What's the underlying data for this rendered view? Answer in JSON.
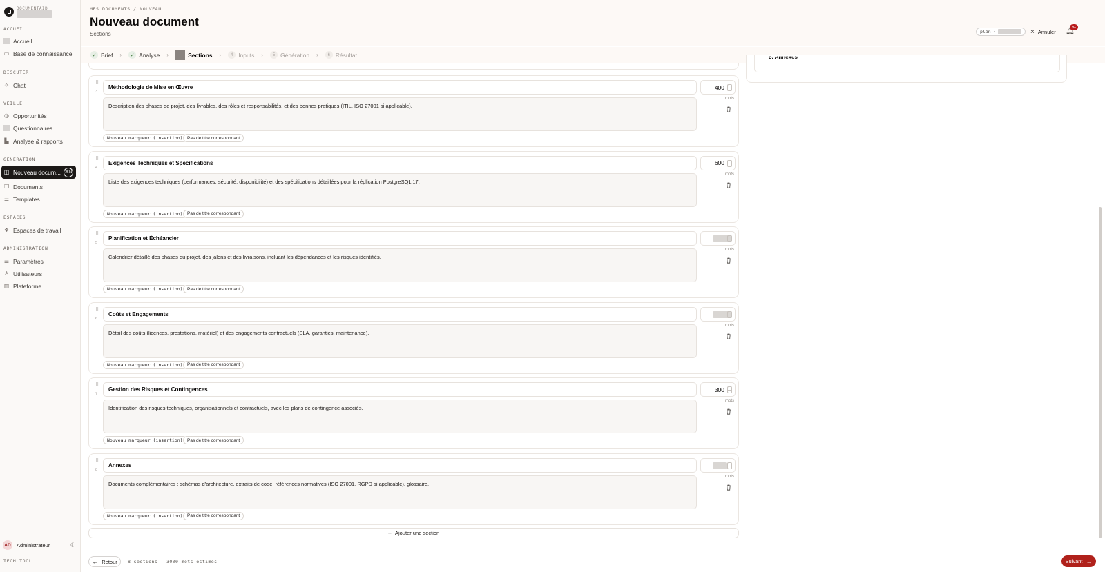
{
  "sidebar": {
    "brand": "DOCUMENTAID",
    "sections": [
      {
        "label": "ACCUEIL",
        "items": [
          {
            "label": "Accueil",
            "icon": "square-icon"
          },
          {
            "label": "Base de connaissance",
            "icon": "book-icon"
          }
        ]
      },
      {
        "label": "DISCUTER",
        "items": [
          {
            "label": "Chat",
            "icon": "sparkle-icon"
          }
        ]
      },
      {
        "label": "VEILLE",
        "items": [
          {
            "label": "Opportunités",
            "icon": "radar-icon"
          },
          {
            "label": "Questionnaires",
            "icon": "square-icon"
          },
          {
            "label": "Analyse & rapports",
            "icon": "chart-icon"
          }
        ]
      },
      {
        "label": "GÉNÉRATION",
        "items": [
          {
            "label": "Nouveau docum...",
            "icon": "file-icon",
            "active": true,
            "badge": "⌘N"
          },
          {
            "label": "Documents",
            "icon": "files-icon"
          },
          {
            "label": "Templates",
            "icon": "template-icon"
          }
        ]
      },
      {
        "label": "ESPACES",
        "items": [
          {
            "label": "Espaces de travail",
            "icon": "workspace-icon"
          }
        ]
      },
      {
        "label": "ADMINISTRATION",
        "items": [
          {
            "label": "Paramètres",
            "icon": "sliders-icon"
          },
          {
            "label": "Utilisateurs",
            "icon": "users-icon"
          },
          {
            "label": "Plateforme",
            "icon": "bars-icon"
          }
        ]
      }
    ],
    "user": {
      "initials": "AD",
      "name": "Administrateur"
    },
    "footer_label": "TECH TOOL"
  },
  "header": {
    "breadcrumb": "MES DOCUMENTS  /  NOUVEAU",
    "title": "Nouveau document",
    "subtitle": "Sections",
    "plan_label": "plan ·",
    "cancel_label": "Annuler",
    "notifications_badge": "9+"
  },
  "steps": [
    {
      "label": "Brief",
      "state": "done"
    },
    {
      "label": "Analyse",
      "state": "done"
    },
    {
      "label": "Sections",
      "state": "current"
    },
    {
      "label": "Inputs",
      "state": "pending",
      "number": "4"
    },
    {
      "label": "Génération",
      "state": "pending",
      "number": "5"
    },
    {
      "label": "Résultat",
      "state": "pending",
      "number": "6"
    }
  ],
  "sections": [
    {
      "index": "3",
      "title": "Méthodologie de Mise en Œuvre",
      "words": "400",
      "description": "Description des phases de projet, des livrables, des rôles et responsabilités, et des bonnes pratiques (ITIL, ISO 27001 si applicable)."
    },
    {
      "index": "4",
      "title": "Exigences Techniques et Spécifications",
      "words": "600",
      "description": "Liste des exigences techniques (performances, sécurité, disponibilité) et des spécifications détaillées pour la réplication PostgreSQL 17."
    },
    {
      "index": "5",
      "title": "Planification et Échéancier",
      "words": "",
      "description": "Calendrier détaillé des phases du projet, des jalons et des livraisons, incluant les dépendances et les risques identifiés."
    },
    {
      "index": "6",
      "title": "Coûts et Engagements",
      "words": "",
      "description": "Détail des coûts (licences, prestations, matériel) et des engagements contractuels (SLA, garanties, maintenance)."
    },
    {
      "index": "7",
      "title": "Gestion des Risques et Contingences",
      "words": "300",
      "description": "Identification des risques techniques, organisationnels et contractuels, avec les plans de contingence associés."
    },
    {
      "index": "8",
      "title": "Annexes",
      "words": "",
      "description": "Documents complémentaires : schémas d'architecture, extraits de code, références normatives (ISO 27001, RGPD si applicable), glossaire."
    }
  ],
  "section_labels": {
    "words_unit": "mots",
    "marker_tag": "Nouveau marqueur (insertion)",
    "title_tag": "Pas de titre correspondant"
  },
  "add_section_label": "Ajouter une section",
  "right_panel": {
    "visible_heading": "8. Annexes"
  },
  "footer": {
    "back_label": "Retour",
    "summary": "8 sections · 3000 mots estimés",
    "next_label": "Suivant"
  }
}
